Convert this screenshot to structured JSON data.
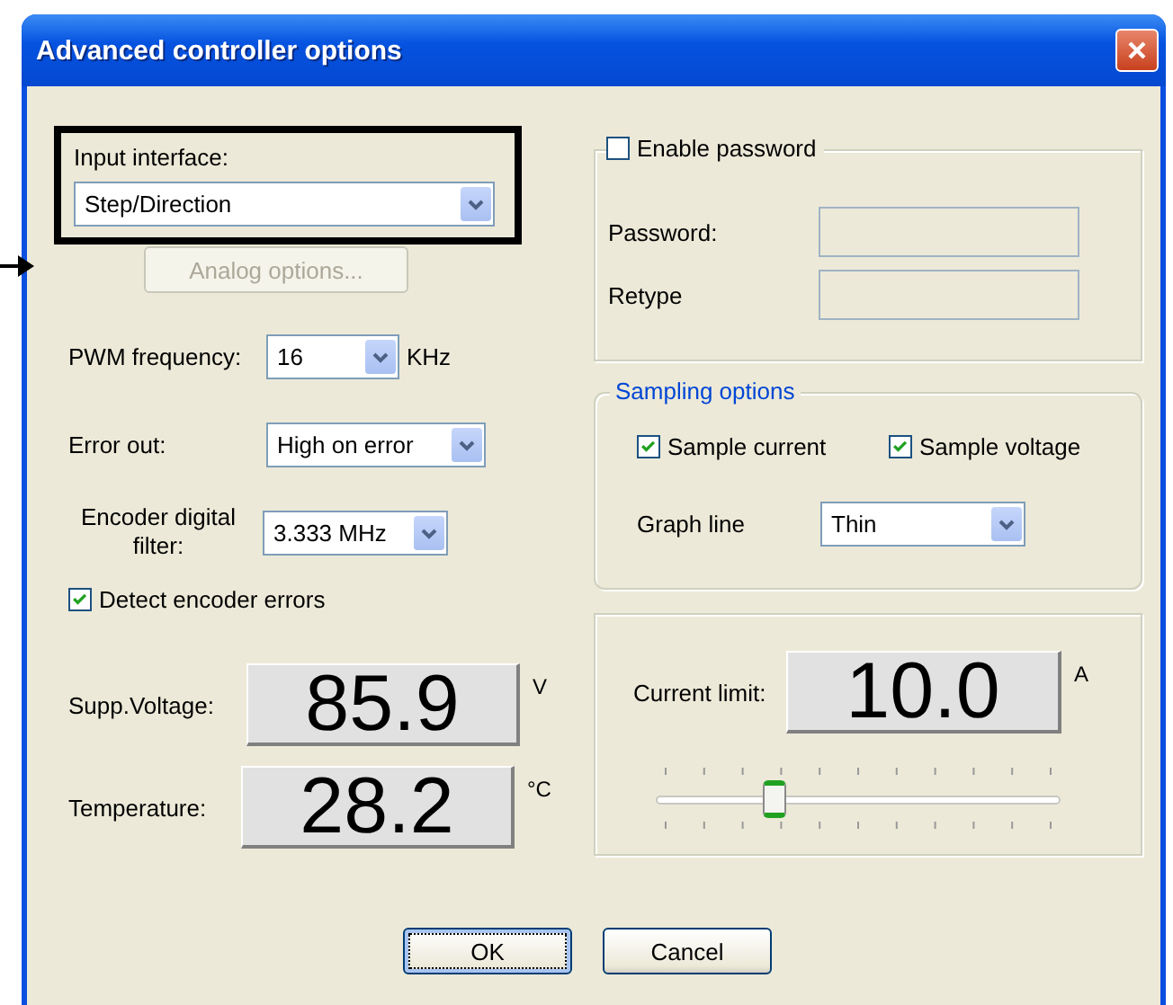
{
  "window": {
    "title": "Advanced controller options"
  },
  "input_interface": {
    "label": "Input interface:",
    "value": "Step/Direction"
  },
  "analog_button": {
    "label": "Analog options...",
    "disabled": true
  },
  "pwm_frequency": {
    "label": "PWM frequency:",
    "value": "16",
    "unit": "KHz"
  },
  "error_out": {
    "label": "Error out:",
    "value": "High on error"
  },
  "encoder_filter": {
    "label": "Encoder digital filter:",
    "value": "3.333 MHz"
  },
  "detect_encoder_errors": {
    "label": "Detect encoder errors",
    "checked": true
  },
  "readouts": [
    {
      "label": "Supp.Voltage:",
      "value": "85.9",
      "unit": "V"
    },
    {
      "label": "Temperature:",
      "value": "28.2",
      "unit": "°C"
    }
  ],
  "password": {
    "label": "Enable password",
    "checked": false,
    "password_label": "Password:",
    "retype_label": "Retype"
  },
  "sampling": {
    "title": "Sampling options",
    "options": [
      {
        "label": "Sample current",
        "checked": true
      },
      {
        "label": "Sample voltage",
        "checked": true
      }
    ],
    "graph_line": {
      "label": "Graph line",
      "value": "Thin"
    }
  },
  "current_limit": {
    "label": "Current limit:",
    "value": "10.0",
    "unit": "A",
    "level": 0.28
  },
  "buttons": [
    {
      "label": "OK",
      "default": true
    },
    {
      "label": "Cancel",
      "default": false
    }
  ]
}
